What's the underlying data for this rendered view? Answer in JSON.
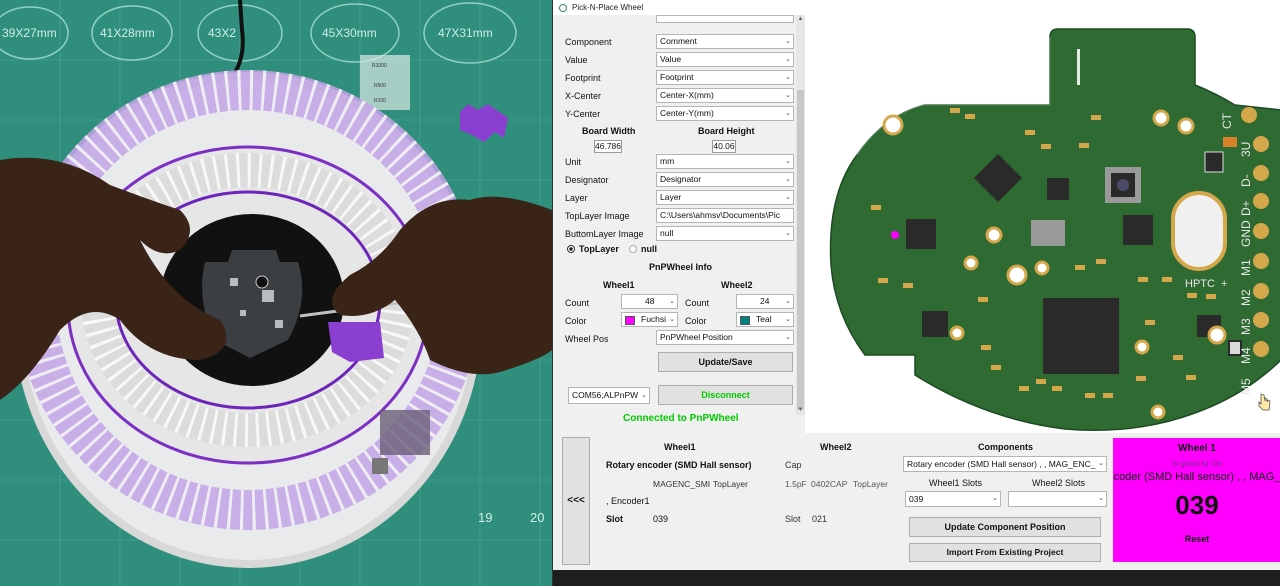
{
  "photo": {
    "mat_labels": [
      "39X27mm",
      "41X28mm",
      "43X2",
      "45X30mm",
      "47X31mm"
    ],
    "mat_numbers": [
      "19",
      "20"
    ],
    "resistor_labels": [
      "R1000",
      "R500",
      "R100"
    ]
  },
  "window": {
    "title": "Pick-N-Place Wheel",
    "fields": [
      {
        "label": "Component",
        "value": "Comment"
      },
      {
        "label": "Value",
        "value": "Value"
      },
      {
        "label": "Footprint",
        "value": "Footprint"
      },
      {
        "label": "X-Center",
        "value": "Center-X(mm)"
      },
      {
        "label": "Y-Center",
        "value": "Center-Y(mm)"
      }
    ],
    "board_width_label": "Board Width",
    "board_width": "46.786",
    "board_height_label": "Board Height",
    "board_height": "40.06",
    "fields2": [
      {
        "label": "Unit",
        "value": "mm"
      },
      {
        "label": "Designator",
        "value": "Designator"
      },
      {
        "label": "Layer",
        "value": "Layer"
      },
      {
        "label": "TopLayer Image",
        "value": "C:\\Users\\ahmsv\\Documents\\Pic"
      },
      {
        "label": "ButtomLayer Image",
        "value": "null"
      }
    ],
    "radio_top": "TopLayer",
    "radio_null": "null",
    "pnp_info_title": "PnPWheel Info",
    "wheel1": {
      "title": "Wheel1",
      "count_label": "Count",
      "count": "48",
      "color_label": "Color",
      "color_name": "Fuchsi",
      "color_hex": "#ff00ff"
    },
    "wheel2": {
      "title": "Wheel2",
      "count_label": "Count",
      "count": "24",
      "color_label": "Color",
      "color_name": "Teal",
      "color_hex": "#008080"
    },
    "wheel_pos_label": "Wheel Pos",
    "wheel_pos_value": "PnPWheel Position",
    "update_save": "Update/Save",
    "com_port": "COM56;ALPnPW",
    "disconnect": "Disconnect",
    "status": "Connected to PnPWheel",
    "status_color": "#00cc00"
  },
  "pcb": {
    "pin_labels": [
      "CT",
      "3U",
      "D-",
      "D+",
      "GND",
      "M1",
      "M2",
      "M3",
      "M4",
      "M5",
      "HPTC",
      "+"
    ]
  },
  "bottom": {
    "back_button": "<<<",
    "wheel1_header": "Wheel1",
    "wheel2_header": "Wheel2",
    "components_header": "Components",
    "w1_component": "Rotary encoder (SMD Hall sensor)",
    "w1_footprint": "MAGENC_SMI",
    "w1_layer": "TopLayer",
    "w1_designator": ", Encoder1",
    "w1_slot_label": "Slot",
    "w1_slot": "039",
    "w2_component": "Cap",
    "w2_value": "1.5pF",
    "w2_footprint": "0402CAP",
    "w2_layer": "TopLayer",
    "w2_slot_label": "Slot",
    "w2_slot": "021",
    "components_select": "Rotary encoder (SMD Hall sensor) , , MAG_ENC_",
    "wheel1_slots_label": "Wheel1 Slots",
    "wheel2_slots_label": "Wheel2 Slots",
    "wheel1_slot_select": "039",
    "wheel2_slot_select": "",
    "update_position": "Update Component Position",
    "import_project": "Import From Existing Project"
  },
  "wheel_box": {
    "title": "Wheel 1",
    "subtitle": "is good to Go",
    "component": "coder (SMD Hall sensor) , , MAG_",
    "slot": "039",
    "reset": "Reset",
    "color": "#ff00ff"
  }
}
